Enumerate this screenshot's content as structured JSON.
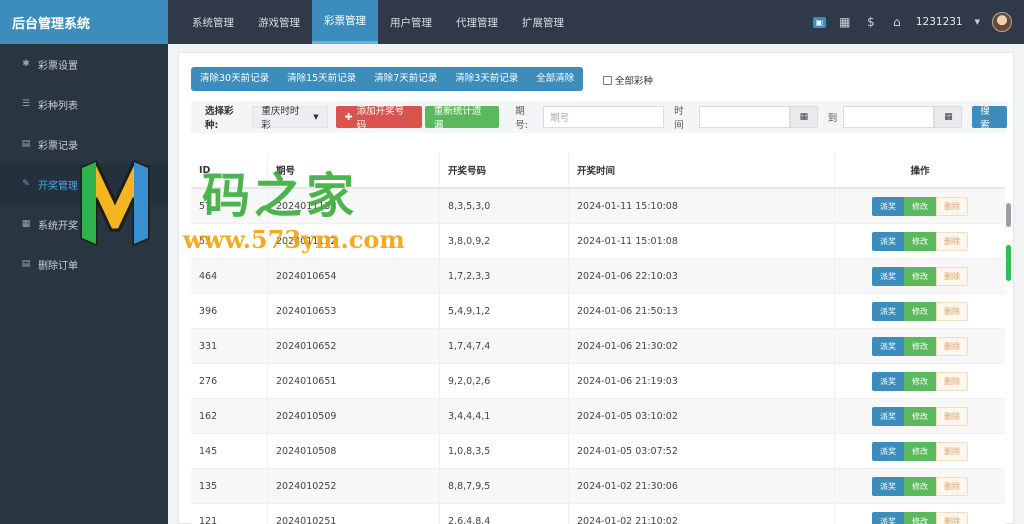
{
  "app": {
    "title": "后台管理系统"
  },
  "topnav": [
    {
      "label": "系统管理",
      "active": false
    },
    {
      "label": "游戏管理",
      "active": false
    },
    {
      "label": "彩票管理",
      "active": true
    },
    {
      "label": "用户管理",
      "active": false
    },
    {
      "label": "代理管理",
      "active": false
    },
    {
      "label": "扩展管理",
      "active": false
    }
  ],
  "topbar": {
    "username": "1231231",
    "icons": [
      "message-icon",
      "qrcode-icon",
      "dollar-icon",
      "home-icon"
    ]
  },
  "sidebar": {
    "items": [
      {
        "label": "彩票设置",
        "icon": "gear-icon",
        "active": false
      },
      {
        "label": "彩种列表",
        "icon": "list-icon",
        "active": false
      },
      {
        "label": "彩票记录",
        "icon": "book-icon",
        "active": false
      },
      {
        "label": "开奖管理",
        "icon": "wrench-icon",
        "active": true
      },
      {
        "label": "系统开奖",
        "icon": "grid-icon",
        "active": false
      },
      {
        "label": "删除订单",
        "icon": "book-icon",
        "active": false
      }
    ]
  },
  "clearbar": {
    "buttons": [
      "清除30天前记录",
      "清除15天前记录",
      "清除7天前记录",
      "清除3天前记录",
      "全部清除"
    ],
    "all_label": "全部彩种"
  },
  "filter": {
    "lottery_label": "选择彩种:",
    "lottery_value": "重庆时时彩",
    "add_button": "添加开奖号码",
    "recount_button": "重新统计遗漏",
    "issue_label": "期号:",
    "issue_placeholder": "期号",
    "time_label": "时间",
    "to_label": "到",
    "search_button": "搜索"
  },
  "table": {
    "headers": {
      "id": "ID",
      "issue": "期号",
      "numbers": "开奖号码",
      "time": "开奖时间",
      "ops": "操作"
    },
    "op_labels": {
      "pay": "派奖",
      "edit": "修改",
      "delete": "删除"
    },
    "rows": [
      {
        "id": "57",
        "issue": "2024011133",
        "numbers": "8,3,5,3,0",
        "time": "2024-01-11 15:10:08"
      },
      {
        "id": "53",
        "issue": "2024011132",
        "numbers": "3,8,0,9,2",
        "time": "2024-01-11 15:01:08"
      },
      {
        "id": "464",
        "issue": "2024010654",
        "numbers": "1,7,2,3,3",
        "time": "2024-01-06 22:10:03"
      },
      {
        "id": "396",
        "issue": "2024010653",
        "numbers": "5,4,9,1,2",
        "time": "2024-01-06 21:50:13"
      },
      {
        "id": "331",
        "issue": "2024010652",
        "numbers": "1,7,4,7,4",
        "time": "2024-01-06 21:30:02"
      },
      {
        "id": "276",
        "issue": "2024010651",
        "numbers": "9,2,0,2,6",
        "time": "2024-01-06 21:19:03"
      },
      {
        "id": "162",
        "issue": "2024010509",
        "numbers": "3,4,4,4,1",
        "time": "2024-01-05 03:10:02"
      },
      {
        "id": "145",
        "issue": "2024010508",
        "numbers": "1,0,8,3,5",
        "time": "2024-01-05 03:07:52"
      },
      {
        "id": "135",
        "issue": "2024010252",
        "numbers": "8,8,7,9,5",
        "time": "2024-01-02 21:30:06"
      },
      {
        "id": "121",
        "issue": "2024010251",
        "numbers": "2,6,4,8,4",
        "time": "2024-01-02 21:10:02"
      }
    ]
  },
  "watermark": {
    "title": "码之家",
    "url": "www.573ym.com"
  },
  "colors": {
    "brand": "#3c8dbc",
    "topbar": "#2f3947",
    "sidebar": "#2a3542",
    "danger": "#d9534f",
    "success": "#5cb85c"
  }
}
